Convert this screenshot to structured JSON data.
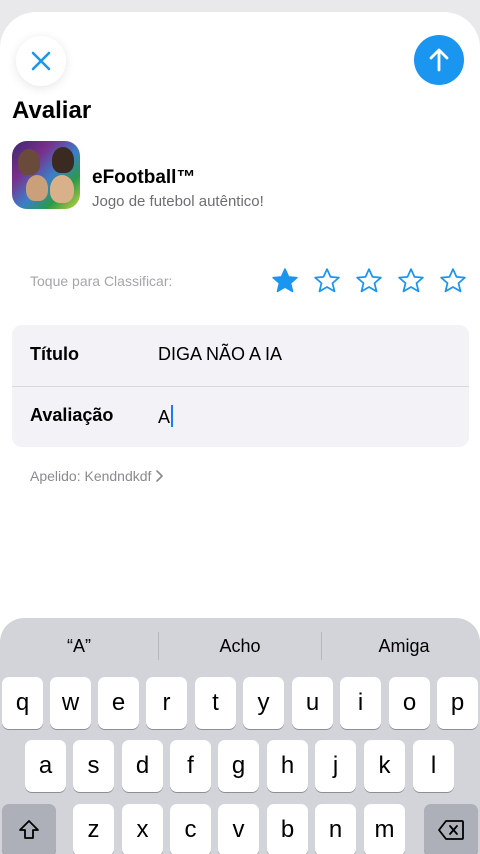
{
  "header": {
    "title": "Avaliar",
    "close_icon": "close-icon",
    "submit_icon": "arrow-up-icon",
    "accent_color": "#1a96f0"
  },
  "app": {
    "name": "eFootball™",
    "subtitle": "Jogo de futebol autêntico!"
  },
  "rating": {
    "label": "Toque para Classificar:",
    "value": 1,
    "max": 5
  },
  "form": {
    "title_label": "Título",
    "title_value": "DIGA NÃO A IA",
    "review_label": "Avaliação",
    "review_value": "A"
  },
  "nickname": {
    "text": "Apelido: Kendndkdf",
    "chevron": "›"
  },
  "keyboard": {
    "suggestions": [
      "“A”",
      "Acho",
      "Amiga"
    ],
    "row1": [
      "q",
      "w",
      "e",
      "r",
      "t",
      "y",
      "u",
      "i",
      "o",
      "p"
    ],
    "row2": [
      "a",
      "s",
      "d",
      "f",
      "g",
      "h",
      "j",
      "k",
      "l"
    ],
    "row3": [
      "z",
      "x",
      "c",
      "v",
      "b",
      "n",
      "m"
    ],
    "shift_icon": "shift-icon",
    "delete_icon": "backspace-icon"
  }
}
